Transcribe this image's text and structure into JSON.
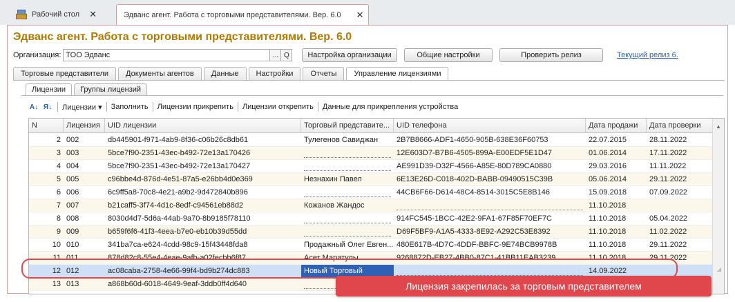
{
  "window_tabs": {
    "home_label": "Рабочий стол",
    "active_label": "Эдванс агент. Работа с торговыми представителями. Вер. 6.0",
    "close_glyph": "✕"
  },
  "page_title": "Эдванс агент. Работа с торговыми представителями. Вер. 6.0",
  "org": {
    "label": "Организация:",
    "value": "ТОО Эдванс",
    "pick_glyph": "...",
    "search_glyph": "Q"
  },
  "header_buttons": {
    "org_settings": "Настройка организации",
    "general_settings": "Общие настройки",
    "check_release": "Проверить релиз",
    "current_release_link": "Текущий релиз 6."
  },
  "main_tabs": [
    {
      "label": "Торговые представители"
    },
    {
      "label": "Документы агентов"
    },
    {
      "label": "Данные"
    },
    {
      "label": "Настройки"
    },
    {
      "label": "Отчеты"
    },
    {
      "label": "Управление лицензиями"
    }
  ],
  "sub_tabs": [
    {
      "label": "Лицензии"
    },
    {
      "label": "Группы лицензий"
    }
  ],
  "toolbar": {
    "sort_asc_glyph": "А↓",
    "sort_desc_glyph": "Я↓",
    "licenses_menu": "Лицензии ▾",
    "fill": "Заполнить",
    "attach": "Лицензии прикрепить",
    "detach": "Лицензии открепить",
    "device_data": "Данные для прикрепления устройства"
  },
  "table": {
    "columns": [
      "N",
      "Лицензия",
      "UID лицензии",
      "Торговый представите...",
      "UID телефона",
      "Дата продажи",
      "Дата проверки"
    ],
    "rows": [
      {
        "n": "2",
        "license": "002",
        "uid": "db445901-f971-4ab9-8f36-c06b26c8db61",
        "rep": "Тулегенов Савиджан",
        "phone": "2B7B8666-ADF1-4650-905B-638E36F60753",
        "sold": "22.07.2015",
        "checked": "28.11.2022"
      },
      {
        "n": "3",
        "license": "003",
        "uid": "5bce7f90-2351-43ec-b492-72e13a170426",
        "rep": "",
        "phone": "12E603D7-B7B6-4505-899A-E00EDF5E1D47",
        "sold": "01.06.2014",
        "checked": "17.11.2022"
      },
      {
        "n": "4",
        "license": "004",
        "uid": "5bce7f90-2351-43ec-b492-72e13a170427",
        "rep": "",
        "phone": "AE991D39-D32F-4566-A85E-80D789CA0880",
        "sold": "29.03.2016",
        "checked": "11.11.2022"
      },
      {
        "n": "5",
        "license": "005",
        "uid": "c96bbe4d-876d-4e51-87a5-e26bb4d0e369",
        "rep": "Незнахин Павел",
        "phone": "6E13E26D-C018-402D-BABB-09490515C39B",
        "sold": "05.06.2014",
        "checked": "29.11.2022"
      },
      {
        "n": "6",
        "license": "006",
        "uid": "6c9ff5a8-70c8-4e21-a9b2-9d472840b896",
        "rep": "",
        "phone": "44CB6F66-D614-48C4-8514-3015C5E8B146",
        "sold": "15.09.2018",
        "checked": "07.09.2022"
      },
      {
        "n": "7",
        "license": "007",
        "uid": "b21caff5-3f74-4d1c-8edf-c94561eb88d2",
        "rep": "Кожанов Жандос",
        "phone": "",
        "sold": "11.10.2018",
        "checked": ""
      },
      {
        "n": "8",
        "license": "008",
        "uid": "8030d4d7-5d6a-44ab-9a70-8b9185f78110",
        "rep": "",
        "phone": "914FC545-1BCC-42E2-9FA1-67F85F70EF7C",
        "sold": "11.10.2018",
        "checked": "05.04.2022"
      },
      {
        "n": "9",
        "license": "009",
        "uid": "b659f6f6-41f3-4eea-b7e0-eb10b39d55dd",
        "rep": "",
        "phone": "D69F5BF9-A1A5-4333-8E92-A292C53E8392",
        "sold": "11.10.2018",
        "checked": "11.02.2022"
      },
      {
        "n": "10",
        "license": "010",
        "uid": "341ba7ca-e624-4cdd-98c9-15f43448fda8",
        "rep": "Продажный Олег Евген...",
        "phone": "480E617B-4D7C-4DDF-BBFC-9E74BCB9978B",
        "sold": "11.10.2018",
        "checked": "29.11.2022"
      },
      {
        "n": "11",
        "license": "011",
        "uid": "878d82c8-55e4-4eae-9afb-a02fecbb6f87",
        "rep": "Асет Маратулы",
        "phone": "9268872D-EB27-4BB0-87C1-41BB11EAB3239",
        "sold": "11.10.2018",
        "checked": "29.11.2022"
      },
      {
        "n": "12",
        "license": "012",
        "uid": "ac08caba-2758-4e66-99f4-bd9b274dc883",
        "rep": "Новый Торговый",
        "phone": "",
        "sold": "14.09.2022",
        "checked": ""
      },
      {
        "n": "13",
        "license": "013",
        "uid": "a868b60d-6018-4649-9eaf-3ddb0ff4d640",
        "rep": "",
        "phone": "",
        "sold": "",
        "checked": ""
      }
    ]
  },
  "callout": "Лицензия закрепилась за торговым представителем",
  "colors": {
    "title": "#b07a00",
    "selection": "#2f62b7",
    "highlight": "#e0474c",
    "row_alt": "#fbf7ea"
  }
}
